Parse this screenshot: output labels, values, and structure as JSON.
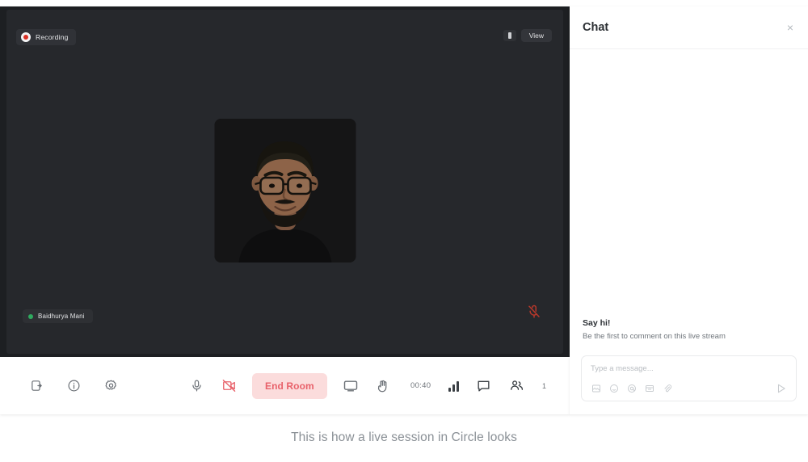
{
  "stage": {
    "recording_label": "Recording",
    "view_label": "View",
    "participant_name": "Baidhurya Mani",
    "participant_status": "online",
    "mic_muted": true,
    "camera_on": false,
    "recording_dot_color": "#d93025",
    "online_dot_color": "#2faa5f"
  },
  "toolbar": {
    "left": [
      {
        "name": "invite-people",
        "icon": "person-add-icon"
      },
      {
        "name": "session-info",
        "icon": "info-icon"
      },
      {
        "name": "settings",
        "icon": "gear-icon"
      }
    ],
    "center": [
      {
        "name": "microphone-toggle",
        "icon": "microphone-icon"
      },
      {
        "name": "camera-toggle",
        "icon": "video-off-icon"
      }
    ],
    "end_room_label": "End Room",
    "screen_share_icon": "screen-share-icon",
    "raise_hand_icon": "raise-hand-icon",
    "timer": "00:40",
    "signal_icon": "signal-bars-icon",
    "chat_icon": "chat-bubble-icon",
    "people_icon": "people-icon",
    "people_count": "1",
    "end_room_bg": "#fbdcdc",
    "end_room_color": "#e8616a"
  },
  "chat": {
    "title": "Chat",
    "close_label": "×",
    "empty_heading": "Say hi!",
    "empty_subtext": "Be the first to comment on this live stream",
    "composer": {
      "placeholder": "Type a message...",
      "tools": [
        {
          "name": "image-tool",
          "icon": "image-icon"
        },
        {
          "name": "emoji-tool",
          "icon": "emoji-icon"
        },
        {
          "name": "mention-tool",
          "icon": "at-mention-icon"
        },
        {
          "name": "gif-tool",
          "icon": "gif-icon"
        },
        {
          "name": "attachment-tool",
          "icon": "paperclip-icon"
        }
      ],
      "send_icon": "send-icon"
    }
  },
  "caption": "This is how a live session in Circle looks"
}
